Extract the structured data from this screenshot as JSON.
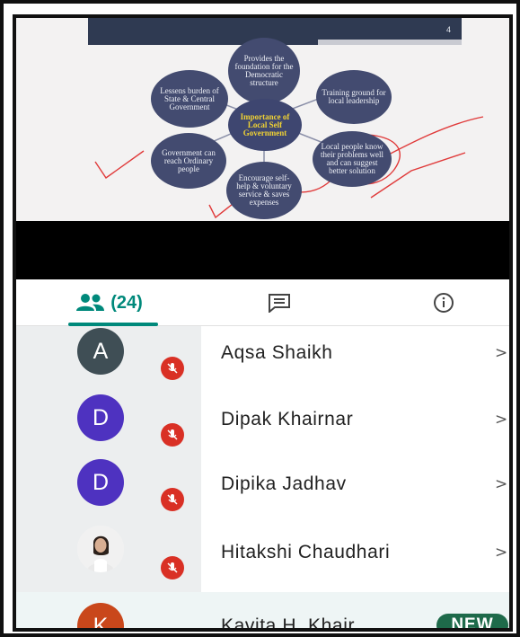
{
  "slide": {
    "page_number": "4",
    "center": "Importance of Local Self Government",
    "nodes": [
      "Provides the foundation for the Democratic structure",
      "Training ground for local leadership",
      "Local people know their problems well and can suggest better solution",
      "Encourage self-help & voluntary service & saves expenses",
      "Government can reach Ordinary people",
      "Lessens burden of State & Central Government"
    ]
  },
  "tabs": {
    "people_count": "(24)",
    "people_icon": "people-icon",
    "chat_icon": "chat-icon",
    "info_icon": "info-icon"
  },
  "participants": [
    {
      "initial": "A",
      "name": "Aqsa Shaikh",
      "avatar_color": "#3f4e55",
      "muted": true,
      "chevron": ">"
    },
    {
      "initial": "D",
      "name": "Dipak Khairnar",
      "avatar_color": "#4e32c0",
      "muted": true,
      "chevron": ">"
    },
    {
      "initial": "D",
      "name": "Dipika Jadhav",
      "avatar_color": "#4e32c0",
      "muted": true,
      "chevron": ">"
    },
    {
      "initial": "",
      "name": "Hitakshi Chaudhari",
      "avatar_color": "#f5f5f5",
      "muted": true,
      "chevron": ">"
    },
    {
      "initial": "K",
      "name": "Kavita H. Khair...",
      "avatar_color": "#c9471b",
      "muted": true,
      "badge": "NEW"
    }
  ],
  "colors": {
    "accent": "#00897b",
    "muted_red": "#d93025",
    "new_badge": "#1e6a4a",
    "annotation_red": "#e03a3a"
  }
}
